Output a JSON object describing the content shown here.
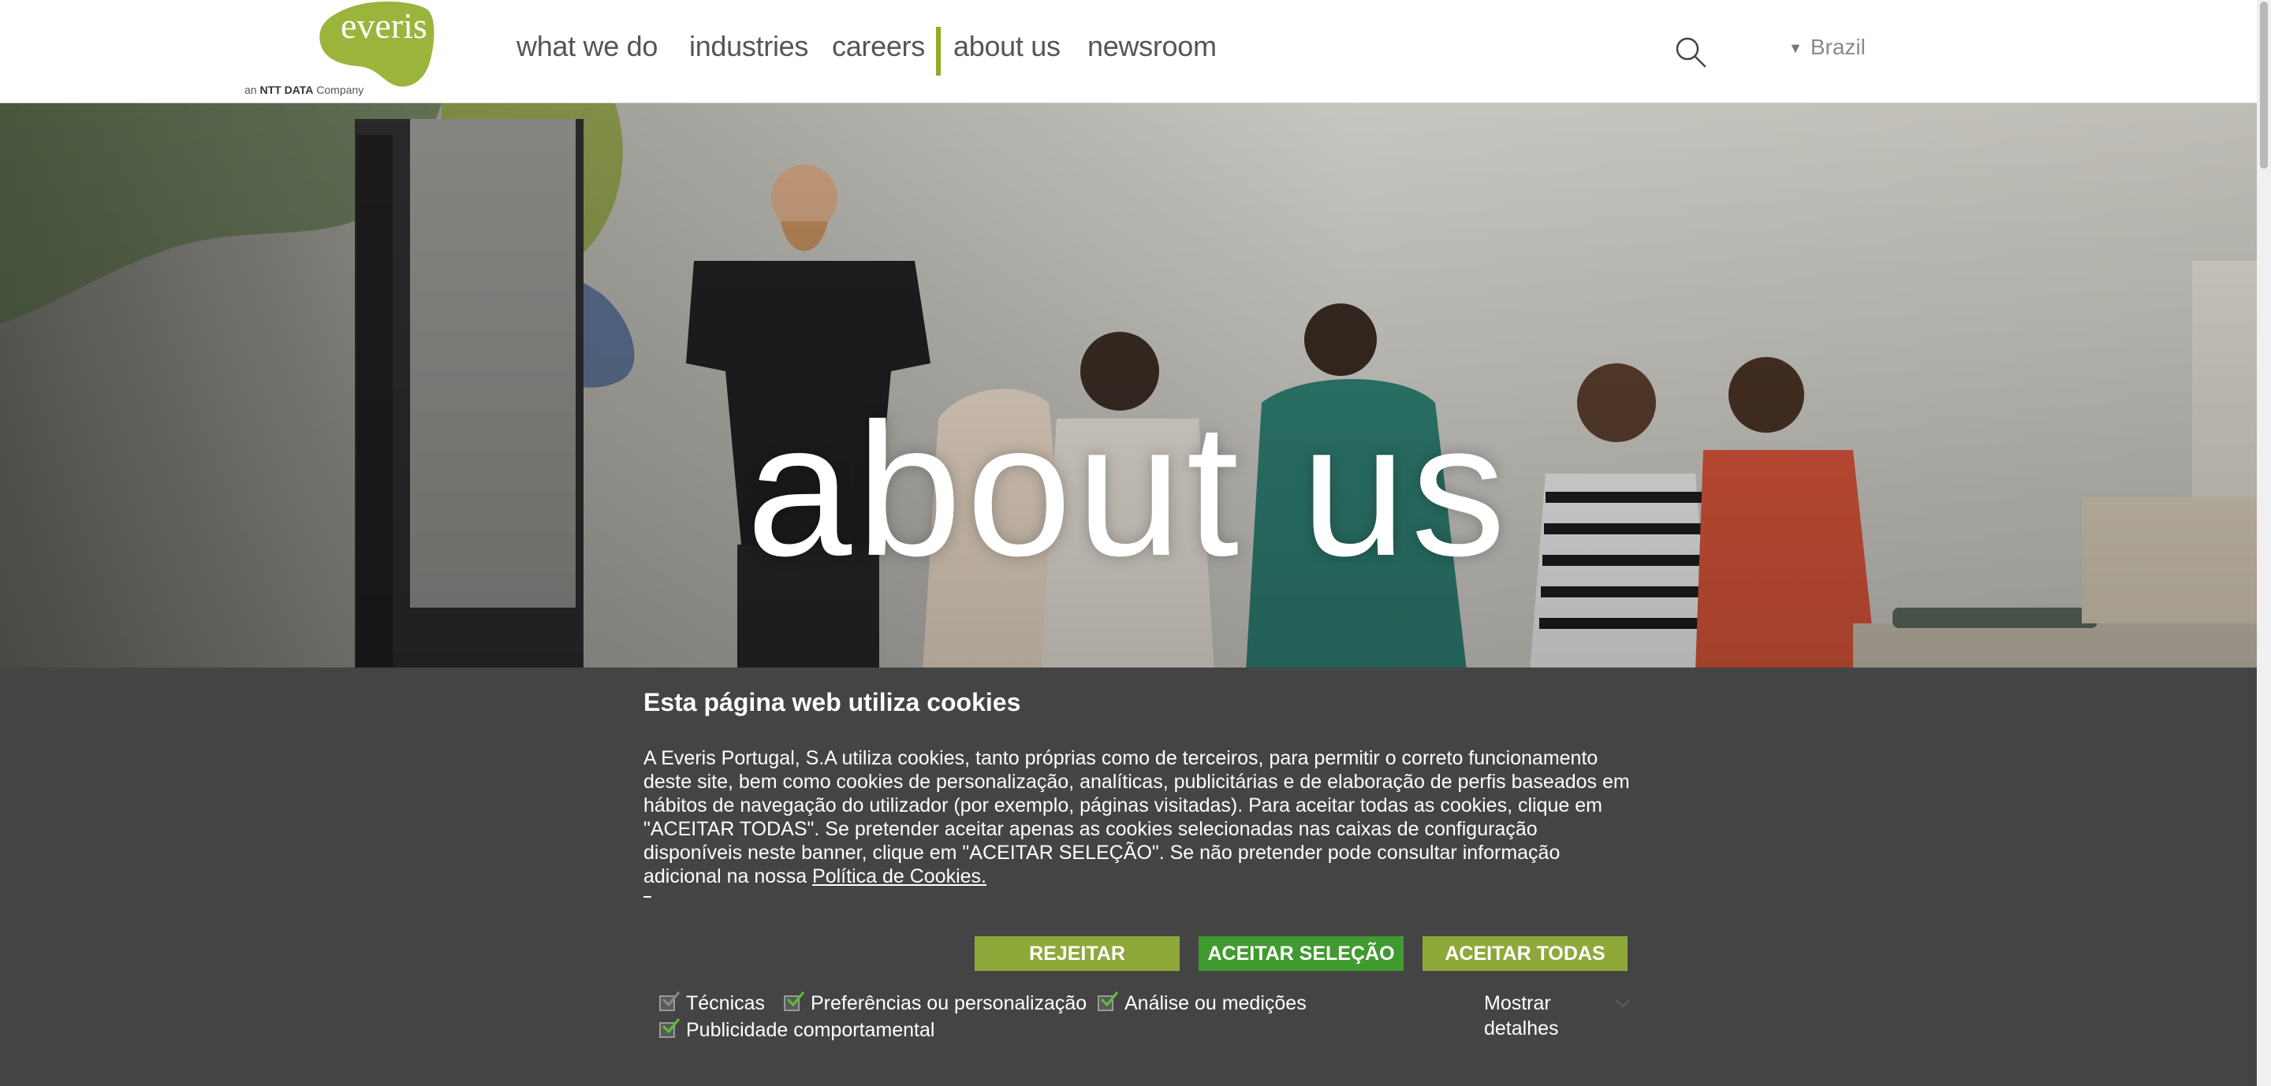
{
  "logo": {
    "word": "everis",
    "tagline_prefix": "an",
    "tagline_brand": "NTT DATA",
    "tagline_suffix": "Company",
    "color": "#9bb43c"
  },
  "nav": {
    "items": [
      {
        "label": "what we do"
      },
      {
        "label": "industries"
      },
      {
        "label": "careers"
      },
      {
        "label": "about us"
      },
      {
        "label": "newsroom"
      }
    ],
    "active": "about us",
    "accent": "#8fae23"
  },
  "header": {
    "search_icon": "search-icon",
    "country": "Brazil"
  },
  "hero": {
    "title": "about us"
  },
  "cookie": {
    "title": "Esta página web utiliza cookies",
    "body": "A Everis Portugal, S.A utiliza cookies, tanto próprias como de terceiros, para permitir o correto funcionamento deste site, bem como cookies de personalização, analíticas, publicitárias e de elaboração de perfis baseados em hábitos de navegação do utilizador (por exemplo, páginas visitadas). Para aceitar todas as cookies, clique em \"ACEITAR TODAS\". Se pretender aceitar apenas as cookies selecionadas nas caixas de configuração disponíveis neste banner, clique em \"ACEITAR SELEÇÃO\". Se não pretender pode consultar informação adicional na nossa",
    "policy_link": "Política de Cookies. ",
    "buttons": {
      "reject": "REJEITAR",
      "accept_selection": "ACEITAR SELEÇÃO",
      "accept_all": "ACEITAR TODAS"
    },
    "options": [
      {
        "label": "Técnicas",
        "checked": true,
        "disabled": true
      },
      {
        "label": "Preferências ou personalização",
        "checked": true
      },
      {
        "label": "Análise ou medições",
        "checked": true
      },
      {
        "label": "Publicidade comportamental",
        "checked": true
      }
    ],
    "details_line1": "Mostrar",
    "details_line2": "detalhes",
    "colors": {
      "banner_bg": "#444444",
      "button_green_light": "#8fa83a",
      "button_green_dark": "#3f9a2f",
      "check": "#5cc23a"
    }
  }
}
